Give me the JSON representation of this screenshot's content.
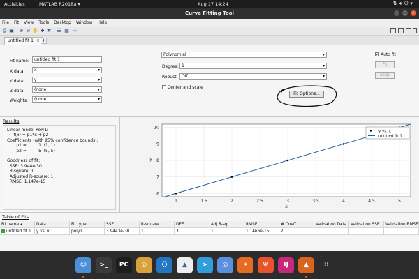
{
  "topbar": {
    "activities": "Activities",
    "app_menu": "MATLAB R2018a ▾",
    "clock": "Aug 17  14:24"
  },
  "window": {
    "title": "Curve Fitting Tool"
  },
  "menu": [
    "File",
    "Fit",
    "View",
    "Tools",
    "Desktop",
    "Window",
    "Help"
  ],
  "tabs": [
    {
      "label": "untitled fit 1",
      "close": "×"
    }
  ],
  "tab_add": "+",
  "setup": {
    "fit_name_label": "Fit name:",
    "fit_name_value": "untitled fit 1",
    "x_label": "X data:",
    "x_value": "x",
    "y_label": "Y data:",
    "y_value": "y",
    "z_label": "Z data:",
    "z_value": "(none)",
    "w_label": "Weights:",
    "w_value": "(none)",
    "fit_type": "Polynomial",
    "degree_label": "Degree:",
    "degree_value": "1",
    "robust_label": "Robust:",
    "robust_value": "Off",
    "center_label": "Center and scale",
    "fit_options_label": "Fit Options...",
    "auto_fit_label": "Auto fit",
    "auto_fit_checked": true,
    "fit_button": "Fit",
    "stop_button": "Stop"
  },
  "results": {
    "header": "Results",
    "lines": [
      "Linear model Poly1:",
      "     f(x) = p1*x + p2",
      "Coefficients (with 95% confidence bounds):",
      "       p1 =         1  (1, 1)",
      "       p2 =         5  (5, 5)",
      "",
      "Goodness of fit:",
      "  SSE: 3.944e-30",
      "  R-square: 1",
      "  Adjusted R-square: 1",
      "  RMSE: 1.147e-15"
    ]
  },
  "chart_data": {
    "type": "line",
    "xlabel": "x",
    "ylabel": "y",
    "xlim": [
      0.75,
      5.2
    ],
    "ylim": [
      5.8,
      10.2
    ],
    "xticks": [
      "1",
      "1.5",
      "2",
      "2.5",
      "3",
      "3.5",
      "4",
      "4.5",
      "5"
    ],
    "yticks": [
      "6",
      "7",
      "8",
      "9",
      "10"
    ],
    "grid": true,
    "legend_position": "top-right",
    "series": [
      {
        "name": "y vs. x",
        "kind": "scatter",
        "x": [
          1,
          2,
          3,
          4,
          5
        ],
        "y": [
          6,
          7,
          8,
          9,
          10
        ],
        "color": "#000000"
      },
      {
        "name": "untitled fit 1",
        "kind": "line",
        "x": [
          0.75,
          5.2
        ],
        "y": [
          5.75,
          10.2
        ],
        "color": "#1f5fa8"
      }
    ]
  },
  "table": {
    "header": "Table of Fits",
    "columns": [
      "Fit name ▴",
      "Data",
      "Fit type",
      "SSE",
      "R-square",
      "DFE",
      "Adj R-sq",
      "RMSE",
      "# Coeff",
      "Validation Data",
      "Validation SSE",
      "Validation RMSE"
    ],
    "rows": [
      [
        "untitled fit 1",
        "y vs. x",
        "poly1",
        "3.9443e-30",
        "1",
        "3",
        "1",
        "1.1466e-15",
        "2",
        "",
        "",
        ""
      ]
    ],
    "row_color": "#3aa13a"
  },
  "dock": [
    {
      "name": "finder-icon",
      "glyph": "☺",
      "color": "#4a8fd8"
    },
    {
      "name": "terminal-icon",
      "glyph": ">_",
      "color": "#3b3b3b"
    },
    {
      "name": "pycharm-icon",
      "glyph": "PC",
      "color": "#1d1d1d"
    },
    {
      "name": "chrome-icon",
      "glyph": "◎",
      "color": "#d9a13a"
    },
    {
      "name": "vscode-icon",
      "glyph": "〈〉",
      "color": "#2475c4"
    },
    {
      "name": "inkscape-icon",
      "glyph": "▲",
      "color": "#eeeeee"
    },
    {
      "name": "telegram-icon",
      "glyph": "➤",
      "color": "#2f9edb"
    },
    {
      "name": "chromium-icon",
      "glyph": "◎",
      "color": "#5c8fe0"
    },
    {
      "name": "firefox-icon",
      "glyph": "☀",
      "color": "#e66b22"
    },
    {
      "name": "brave-icon",
      "glyph": "⛨",
      "color": "#e8532c"
    },
    {
      "name": "intellij-icon",
      "glyph": "IJ",
      "color": "#c8287a"
    },
    {
      "name": "matlab-icon",
      "glyph": "▲",
      "color": "#d9641e"
    },
    {
      "name": "apps-grid-icon",
      "glyph": "∷",
      "color": "#2c2c2c"
    }
  ]
}
